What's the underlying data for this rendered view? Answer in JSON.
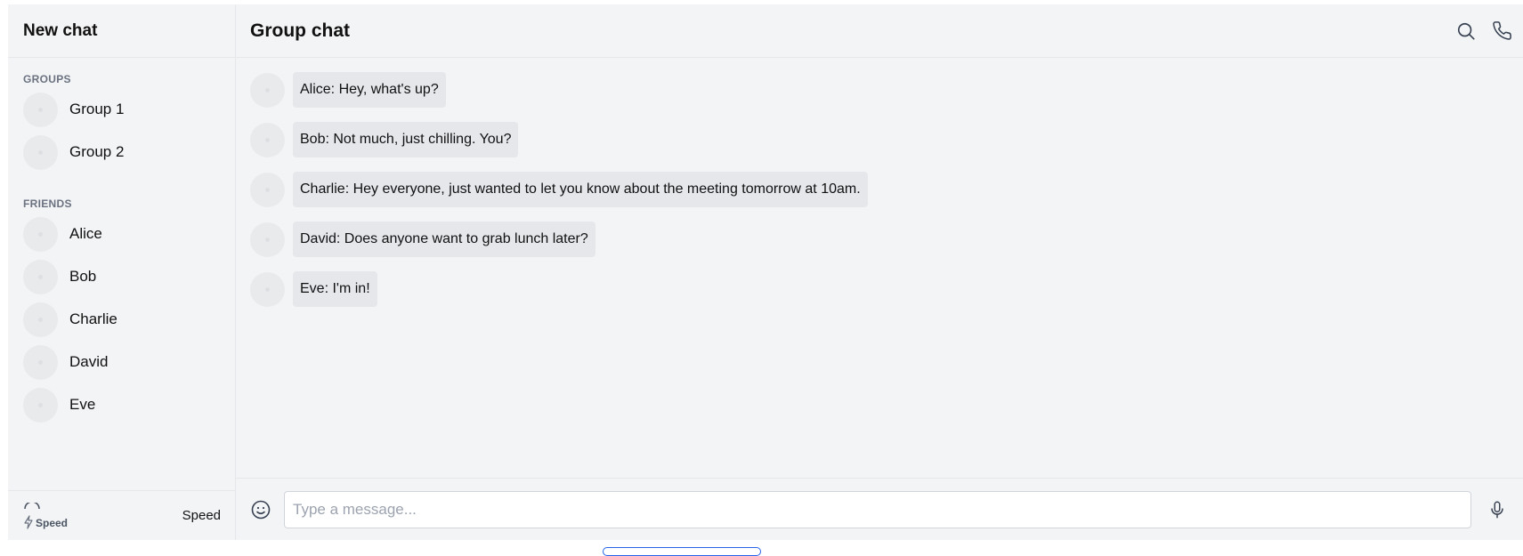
{
  "sidebar": {
    "title": "New chat",
    "groups_label": "GROUPS",
    "groups": [
      {
        "name": "Group 1"
      },
      {
        "name": "Group 2"
      }
    ],
    "friends_label": "FRIENDS",
    "friends": [
      {
        "name": "Alice"
      },
      {
        "name": "Bob"
      },
      {
        "name": "Charlie"
      },
      {
        "name": "David"
      },
      {
        "name": "Eve"
      }
    ],
    "footer": {
      "speed_small_label": "Speed",
      "speed_label": "Speed",
      "icon": "bolt-icon"
    }
  },
  "main": {
    "title": "Group chat",
    "header_icons": [
      "search-icon",
      "phone-icon"
    ],
    "messages": [
      {
        "text": "Alice: Hey, what's up?"
      },
      {
        "text": "Bob: Not much, just chilling. You?"
      },
      {
        "text": "Charlie: Hey everyone, just wanted to let you know about the meeting tomorrow at 10am."
      },
      {
        "text": "David: Does anyone want to grab lunch later?"
      },
      {
        "text": "Eve: I'm in!"
      }
    ],
    "composer": {
      "placeholder": "Type a message...",
      "value": "",
      "left_icon": "emoji-icon",
      "right_icon": "microphone-icon"
    }
  },
  "colors": {
    "app_background": "#f3f4f6",
    "bubble": "#e5e7eb",
    "border": "#e5e7eb",
    "muted_text": "#6b7280"
  }
}
